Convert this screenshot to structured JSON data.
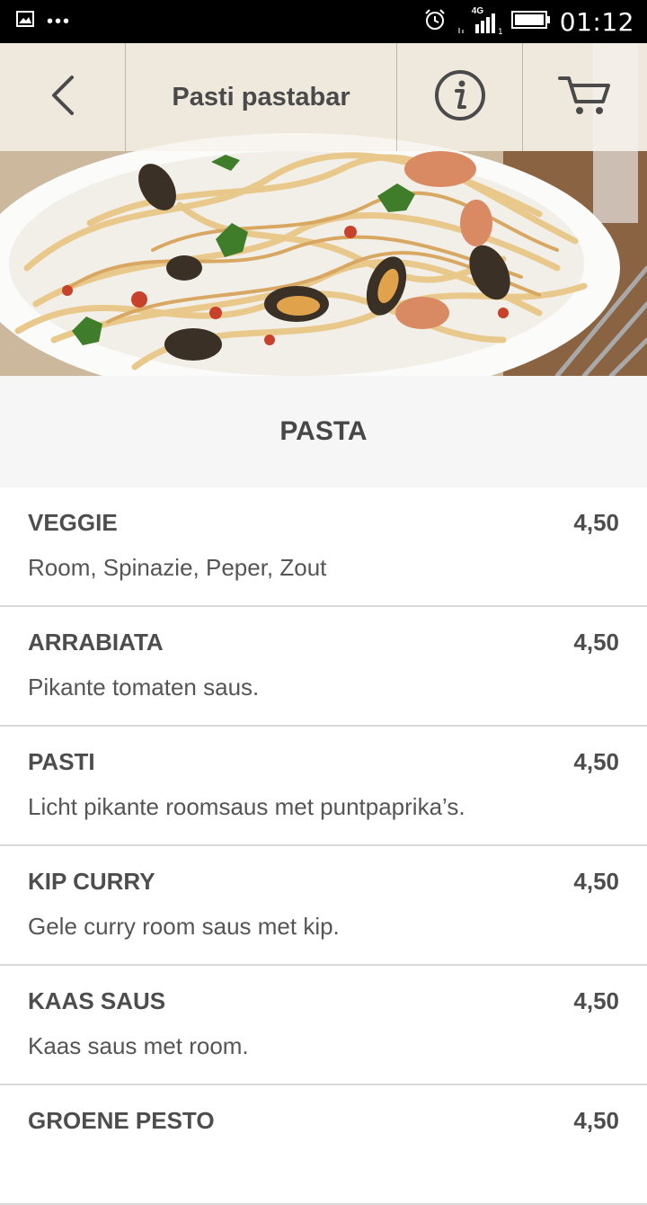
{
  "status_bar": {
    "time": "01:12",
    "network": "4G",
    "icons": [
      "image-icon",
      "more-dots-icon",
      "alarm-icon",
      "signal-icon",
      "battery-icon"
    ]
  },
  "header": {
    "title": "Pasti pastabar",
    "icons": [
      "back-icon",
      "info-icon",
      "cart-icon"
    ]
  },
  "section": {
    "title": "PASTA"
  },
  "menu": {
    "items": [
      {
        "name": "VEGGIE",
        "price": "4,50",
        "description": "Room, Spinazie, Peper, Zout"
      },
      {
        "name": "ARRABIATA",
        "price": "4,50",
        "description": "Pikante tomaten saus."
      },
      {
        "name": "PASTI",
        "price": "4,50",
        "description": "Licht pikante roomsaus met puntpaprika’s."
      },
      {
        "name": "KIP CURRY",
        "price": "4,50",
        "description": "Gele curry room saus met kip."
      },
      {
        "name": "KAAS SAUS",
        "price": "4,50",
        "description": "Kaas saus met room."
      },
      {
        "name": "GROENE PESTO",
        "price": "4,50",
        "description": ""
      }
    ]
  },
  "colors": {
    "status_bar_bg": "#000000",
    "toolbar_bg": "#f8f4ee",
    "section_bg": "#f6f6f6",
    "text": "#4d4d4d",
    "divider": "#d8d8d8"
  }
}
